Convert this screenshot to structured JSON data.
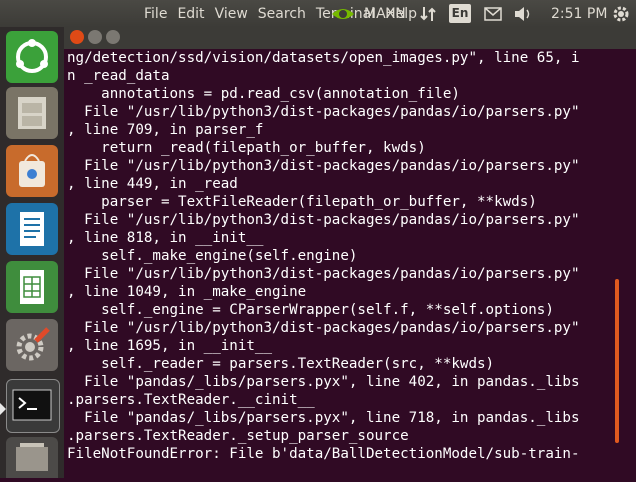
{
  "top_panel": {
    "menu": [
      "File",
      "Edit",
      "View",
      "Search",
      "Terminal",
      "Help"
    ],
    "power_mode": "MAXN",
    "keyboard_layout": "En",
    "clock": "2:51 PM",
    "icons": [
      "nvidia-icon",
      "network-icon",
      "mail-icon",
      "volume-icon",
      "system-gear-icon"
    ]
  },
  "launcher": {
    "items": [
      {
        "name": "dash",
        "icon": "ubuntu-logo-icon"
      },
      {
        "name": "files",
        "icon": "file-cabinet-icon"
      },
      {
        "name": "software-center",
        "icon": "shopping-bag-icon"
      },
      {
        "name": "libreoffice-writer",
        "icon": "document-icon"
      },
      {
        "name": "libreoffice-calc",
        "icon": "spreadsheet-icon"
      },
      {
        "name": "system-settings",
        "icon": "wrench-gear-icon"
      },
      {
        "name": "terminal",
        "icon": "terminal-icon"
      },
      {
        "name": "more",
        "icon": "stacked-app-icon"
      }
    ],
    "colors": {
      "active": "#e8e8e8",
      "accent": "#3ba13a"
    }
  },
  "terminal": {
    "menu": [
      "File",
      "Edit",
      "View",
      "Search",
      "Terminal",
      "Help"
    ],
    "lines": [
      "ng/detection/ssd/vision/datasets/open_images.py\", line 65, i",
      "n _read_data",
      "    annotations = pd.read_csv(annotation_file)",
      "  File \"/usr/lib/python3/dist-packages/pandas/io/parsers.py\"",
      ", line 709, in parser_f",
      "    return _read(filepath_or_buffer, kwds)",
      "  File \"/usr/lib/python3/dist-packages/pandas/io/parsers.py\"",
      ", line 449, in _read",
      "    parser = TextFileReader(filepath_or_buffer, **kwds)",
      "  File \"/usr/lib/python3/dist-packages/pandas/io/parsers.py\"",
      ", line 818, in __init__",
      "    self._make_engine(self.engine)",
      "  File \"/usr/lib/python3/dist-packages/pandas/io/parsers.py\"",
      ", line 1049, in _make_engine",
      "    self._engine = CParserWrapper(self.f, **self.options)",
      "  File \"/usr/lib/python3/dist-packages/pandas/io/parsers.py\"",
      ", line 1695, in __init__",
      "    self._reader = parsers.TextReader(src, **kwds)",
      "  File \"pandas/_libs/parsers.pyx\", line 402, in pandas._libs",
      ".parsers.TextReader.__cinit__",
      "  File \"pandas/_libs/parsers.pyx\", line 718, in pandas._libs",
      ".parsers.TextReader._setup_parser_source",
      "FileNotFoundError: File b'data/BallDetectionModel/sub-train-"
    ],
    "colors": {
      "background": "#300a24",
      "text": "#ffffff",
      "scrollbar": "#e05a1f"
    }
  }
}
